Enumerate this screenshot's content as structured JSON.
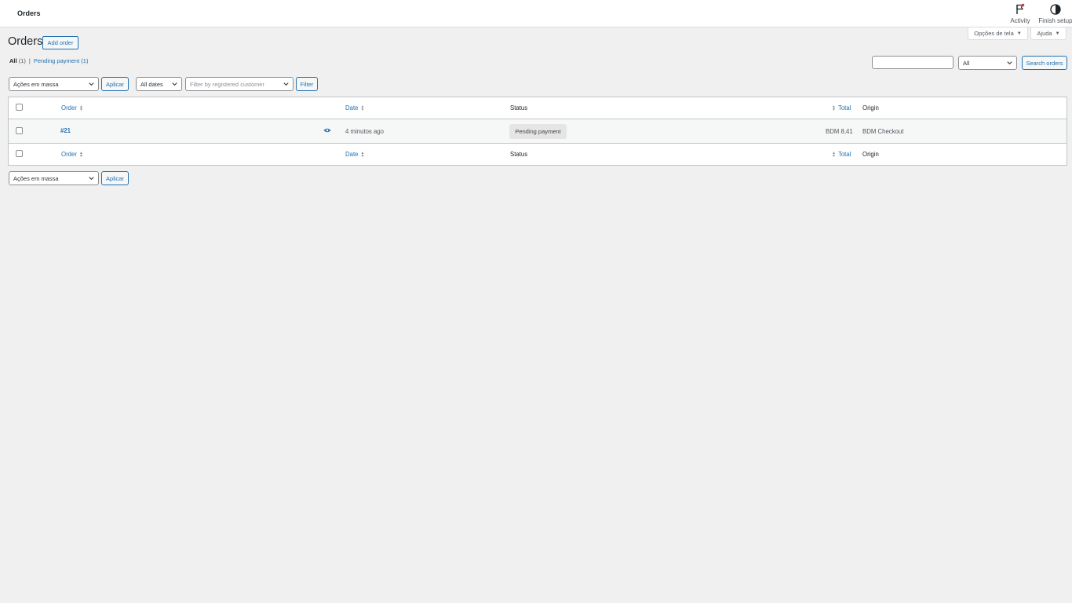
{
  "header": {
    "title": "Orders",
    "activity_label": "Activity",
    "activity_icon": "flag-icon",
    "finish_setup_label": "Finish setup",
    "finish_setup_icon": "half-circle-progress-icon"
  },
  "screen_options": {
    "label": "Opções de tela"
  },
  "help": {
    "label": "Ajuda"
  },
  "page": {
    "title": "Orders",
    "add_order_label": "Add order"
  },
  "views": {
    "all_label": "All",
    "all_count": "(1)",
    "separator": "|",
    "pending_label": "Pending payment",
    "pending_count": "(1)"
  },
  "search": {
    "input_value": "",
    "status_select_value": "All",
    "button_label": "Search orders"
  },
  "tablenav_top": {
    "bulk_actions_value": "Ações em massa",
    "apply_label": "Aplicar",
    "dates_value": "All dates",
    "customer_placeholder": "Filter by registered customer",
    "filter_label": "Filter"
  },
  "table": {
    "columns": {
      "order": "Order",
      "date": "Date",
      "status": "Status",
      "total": "Total",
      "origin": "Origin"
    },
    "rows": [
      {
        "order": "#21",
        "date": "4 minutos ago",
        "status": "Pending payment",
        "total": "BDM 8,41",
        "origin": "BDM Checkout"
      }
    ]
  },
  "tablenav_bottom": {
    "bulk_actions_value": "Ações em massa",
    "apply_label": "Aplicar"
  },
  "colors": {
    "accent": "#2271b1",
    "background": "#f0f0f1",
    "status_pending_bg": "#e5e5e5"
  }
}
